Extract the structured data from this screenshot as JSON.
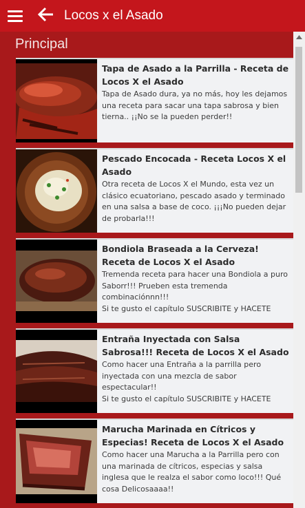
{
  "header": {
    "title": "Locos x el Asado",
    "menu_icon": "hamburger-menu-icon",
    "back_icon": "back-arrow-icon",
    "bg_color": "#c4161c"
  },
  "section": {
    "title": "Principal"
  },
  "videos": [
    {
      "title": "Tapa de Asado a la Parrilla - Receta de Locos X el Asado",
      "description": "Tapa de Asado dura, ya no más, hoy les dejamos una receta para sacar una tapa sabrosa y bien tierna.. ¡¡No se la pueden perder!!"
    },
    {
      "title": "Pescado Encocada - Receta Locos X el Asado",
      "description": "Otra receta de Locos X el Mundo, esta vez un clásico ecuatoriano, pescado asado y terminado en una salsa a base de coco. ¡¡¡No pueden dejar de probarla!!!"
    },
    {
      "title": "Bondiola Braseada a la Cerveza! Receta de Locos X el Asado",
      "description": "Tremenda receta para hacer una Bondiola a puro Saborr!!! Prueben esta tremenda combinaciónnn!!!\nSi te gusto el capítulo SUSCRIBITE y HACETE"
    },
    {
      "title": "Entraña Inyectada con Salsa Sabrosa!!! Receta de Locos X el Asado",
      "description": "Como hacer una Entraña a la parrilla pero inyectada con una mezcla de sabor espectacular!!\nSi te gusto el capítulo SUSCRIBITE y HACETE"
    },
    {
      "title": "Marucha Marinada en Cítricos y Especias! Receta de Locos X el Asado",
      "description": "Como hacer una Marucha a la Parrilla pero con una marinada de cítricos, especias y salsa inglesa que le realza el sabor como loco!!! Qué cosa Delicosaaaa!!"
    }
  ]
}
